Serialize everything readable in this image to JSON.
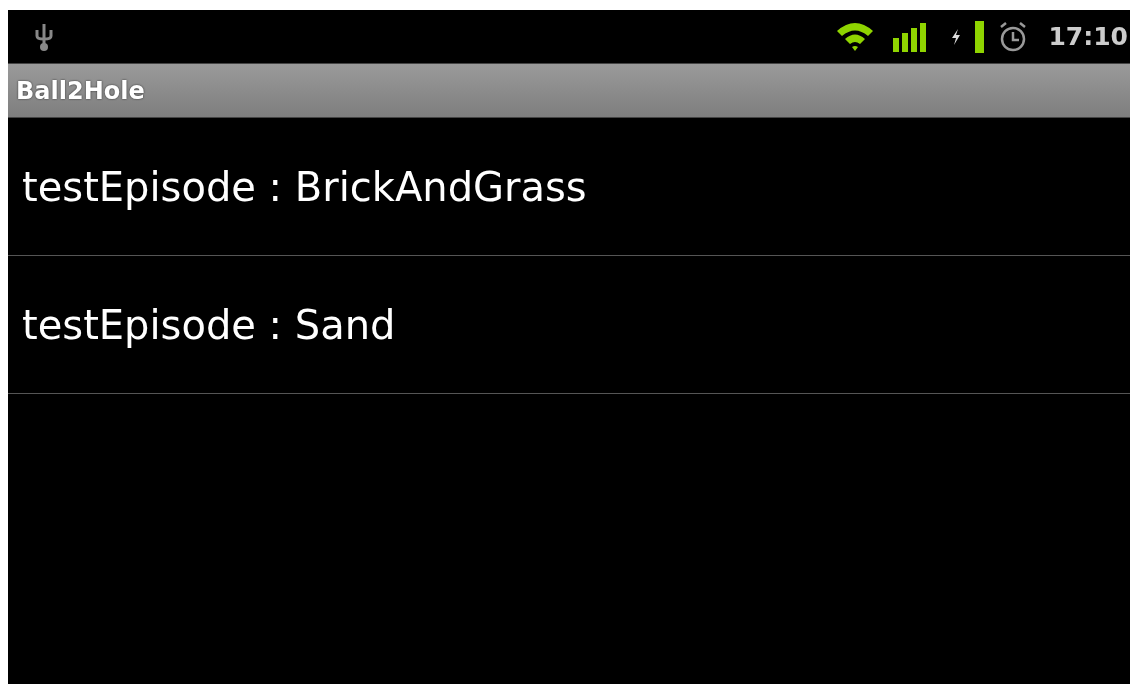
{
  "status_bar": {
    "time": "17:10"
  },
  "title_bar": {
    "title": "Ball2Hole"
  },
  "list": [
    {
      "label": "testEpisode : BrickAndGrass"
    },
    {
      "label": "testEpisode : Sand"
    }
  ]
}
